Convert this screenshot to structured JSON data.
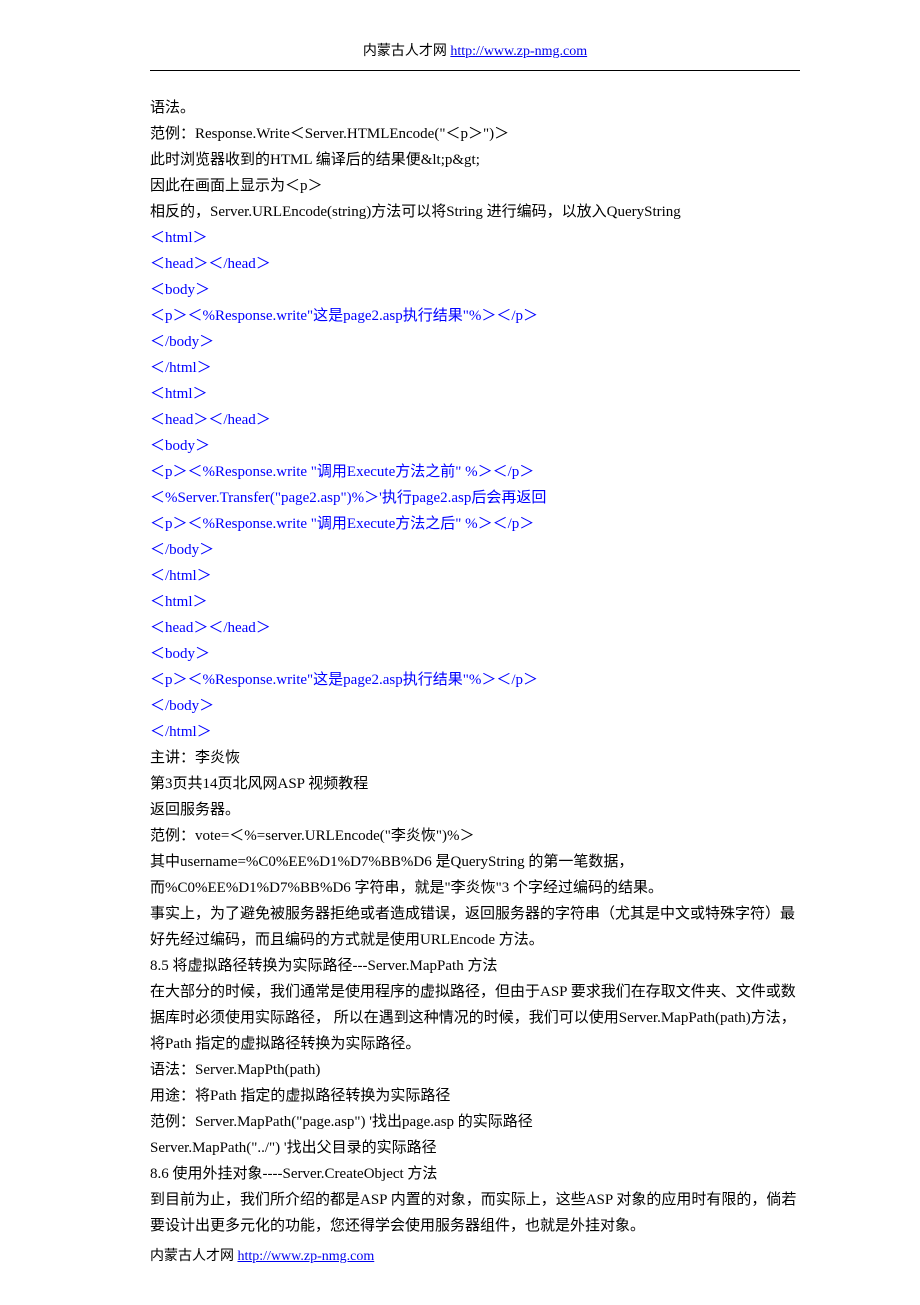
{
  "header": {
    "prefix": "内蒙古人才网",
    "url": "http://www.zp-nmg.com"
  },
  "lines": [
    {
      "text": "语法。",
      "code": false
    },
    {
      "text": "范例：Response.Write＜Server.HTMLEncode(\"＜p＞\")＞",
      "code": false
    },
    {
      "text": "此时浏览器收到的HTML 编译后的结果便&lt;p&gt;",
      "code": false
    },
    {
      "text": "因此在画面上显示为＜p＞",
      "code": false
    },
    {
      "text": "相反的，Server.URLEncode(string)方法可以将String 进行编码，以放入QueryString",
      "code": false
    },
    {
      "text": "＜html＞",
      "code": true
    },
    {
      "text": "＜head＞＜/head＞",
      "code": true
    },
    {
      "text": "＜body＞",
      "code": true
    },
    {
      "text": "＜p＞＜%Response.write\"这是page2.asp执行结果\"%＞＜/p＞",
      "code": true
    },
    {
      "text": "＜/body＞",
      "code": true
    },
    {
      "text": "＜/html＞",
      "code": true
    },
    {
      "text": "＜html＞",
      "code": true
    },
    {
      "text": "＜head＞＜/head＞",
      "code": true
    },
    {
      "text": "＜body＞",
      "code": true
    },
    {
      "text": "＜p＞＜%Response.write \"调用Execute方法之前\" %＞＜/p＞",
      "code": true
    },
    {
      "text": "＜%Server.Transfer(\"page2.asp\")%＞'执行page2.asp后会再返回",
      "code": true
    },
    {
      "text": "＜p＞＜%Response.write \"调用Execute方法之后\" %＞＜/p＞",
      "code": true
    },
    {
      "text": "＜/body＞",
      "code": true
    },
    {
      "text": "＜/html＞",
      "code": true
    },
    {
      "text": "＜html＞",
      "code": true
    },
    {
      "text": "＜head＞＜/head＞",
      "code": true
    },
    {
      "text": "＜body＞",
      "code": true
    },
    {
      "text": "＜p＞＜%Response.write\"这是page2.asp执行结果\"%＞＜/p＞",
      "code": true
    },
    {
      "text": "＜/body＞",
      "code": true
    },
    {
      "text": "＜/html＞",
      "code": true
    },
    {
      "text": "主讲：李炎恢",
      "code": false
    },
    {
      "text": "第3页共14页北风网ASP 视频教程",
      "code": false
    },
    {
      "text": "返回服务器。",
      "code": false
    },
    {
      "text": "范例：vote=＜%=server.URLEncode(\"李炎恢\")%＞",
      "code": false
    },
    {
      "text": "其中username=%C0%EE%D1%D7%BB%D6 是QueryString 的第一笔数据， 而%C0%EE%D1%D7%BB%D6 字符串，就是\"李炎恢\"3 个字经过编码的结果。",
      "code": false
    },
    {
      "text": "事实上，为了避免被服务器拒绝或者造成错误，返回服务器的字符串（尤其是中文或特殊字符）最好先经过编码，而且编码的方式就是使用URLEncode 方法。",
      "code": false
    },
    {
      "text": "8.5 将虚拟路径转换为实际路径---Server.MapPath 方法",
      "code": false
    },
    {
      "text": "在大部分的时候，我们通常是使用程序的虚拟路径，但由于ASP 要求我们在存取文件夹、文件或数据库时必须使用实际路径， 所以在遇到这种情况的时候，我们可以使用Server.MapPath(path)方法，将Path 指定的虚拟路径转换为实际路径。",
      "code": false
    },
    {
      "text": "语法：Server.MapPth(path)",
      "code": false
    },
    {
      "text": "用途：将Path 指定的虚拟路径转换为实际路径",
      "code": false
    },
    {
      "text": "范例：Server.MapPath(\"page.asp\") '找出page.asp 的实际路径",
      "code": false
    },
    {
      "text": "Server.MapPath(\"../\") '找出父目录的实际路径",
      "code": false
    },
    {
      "text": "8.6 使用外挂对象----Server.CreateObject 方法",
      "code": false
    },
    {
      "text": "到目前为止，我们所介绍的都是ASP 内置的对象，而实际上，这些ASP 对象的应用时有限的，倘若要设计出更多元化的功能，您还得学会使用服务器组件，也就是外挂对象。",
      "code": false
    }
  ],
  "footer": {
    "prefix": "内蒙古人才网",
    "url": "http://www.zp-nmg.com"
  }
}
